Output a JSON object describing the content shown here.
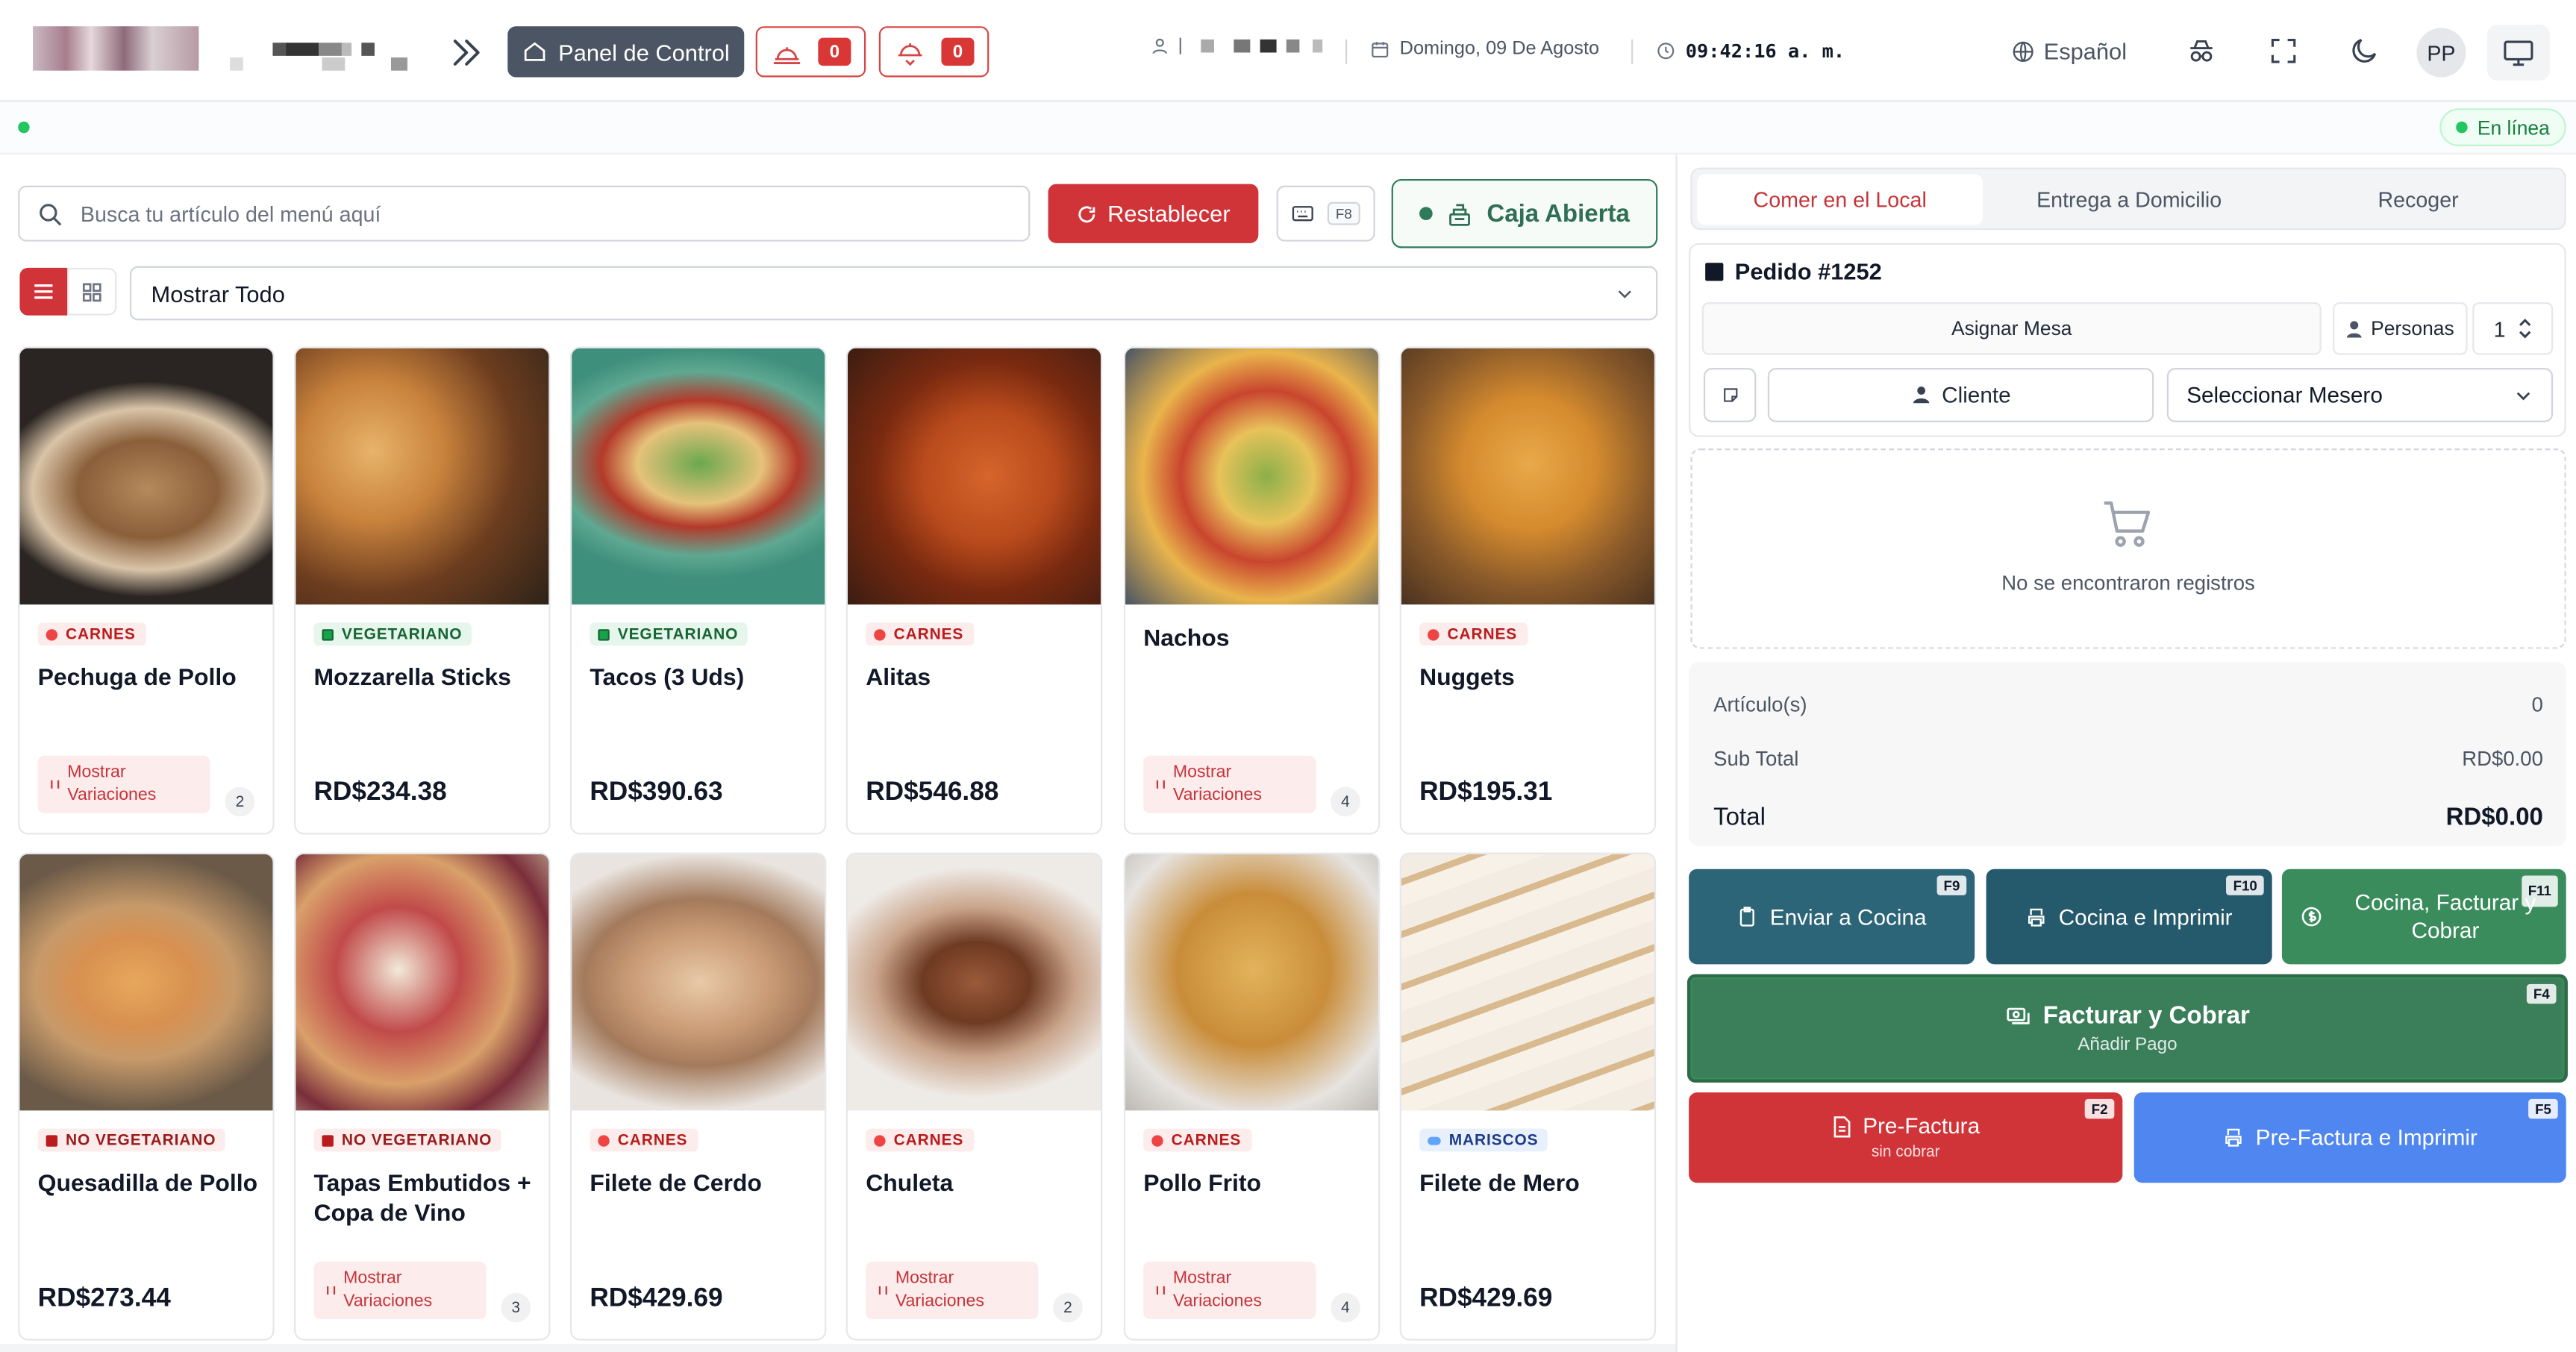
{
  "header": {
    "panel_button": "Panel de Control",
    "bell_count_1": "0",
    "bell_count_2": "0",
    "date": "Domingo, 09 De Agosto",
    "time": "09:42:16 a. m.",
    "language": "Español",
    "avatar": "PP"
  },
  "status": {
    "online": "En línea"
  },
  "toolbar": {
    "search_placeholder": "Busca tu artículo del menú aquí",
    "reset_label": "Restablecer",
    "shortcut_key": "F8",
    "cash_label": "Caja Abierta",
    "filter_value": "Mostrar Todo"
  },
  "menu_items": [
    {
      "name": "Pechuga de Pollo",
      "category": "CARNES",
      "price": "",
      "variations_label": "Mostrar Variaciones",
      "variation_count": "2"
    },
    {
      "name": "Mozzarella Sticks",
      "category": "VEGETARIANO",
      "price": "RD$234.38"
    },
    {
      "name": "Tacos (3 Uds)",
      "category": "VEGETARIANO",
      "price": "RD$390.63"
    },
    {
      "name": "Alitas",
      "category": "CARNES",
      "price": "RD$546.88"
    },
    {
      "name": "Nachos",
      "category": "",
      "price": "",
      "variations_label": "Mostrar Variaciones",
      "variation_count": "4"
    },
    {
      "name": "Nuggets",
      "category": "CARNES",
      "price": "RD$195.31"
    },
    {
      "name": "Quesadilla de Pollo",
      "category": "NO VEGETARIANO",
      "price": "RD$273.44"
    },
    {
      "name": "Tapas Embutidos + Copa de Vino",
      "category": "NO VEGETARIANO",
      "price": "",
      "variations_label": "Mostrar Variaciones",
      "variation_count": "3"
    },
    {
      "name": "Filete de Cerdo",
      "category": "CARNES",
      "price": "RD$429.69"
    },
    {
      "name": "Chuleta",
      "category": "CARNES",
      "price": "",
      "variations_label": "Mostrar Variaciones",
      "variation_count": "2"
    },
    {
      "name": "Pollo Frito",
      "category": "CARNES",
      "price": "",
      "variations_label": "Mostrar Variaciones",
      "variation_count": "4"
    },
    {
      "name": "Filete de Mero",
      "category": "MARISCOS",
      "price": "RD$429.69"
    }
  ],
  "order": {
    "tabs": [
      "Comer en el Local",
      "Entrega a Domicilio",
      "Recoger"
    ],
    "title": "Pedido #1252",
    "assign_table": "Asignar Mesa",
    "persons_label": "Personas",
    "persons_value": "1",
    "client_label": "Cliente",
    "waiter_placeholder": "Seleccionar Mesero",
    "empty_message": "No se encontraron registros",
    "items_label": "Artículo(s)",
    "items_count": "0",
    "subtotal_label": "Sub Total",
    "subtotal_value": "RD$0.00",
    "total_label": "Total",
    "total_value": "RD$0.00"
  },
  "actions": {
    "send_kitchen": "Enviar a Cocina",
    "send_kitchen_key": "F9",
    "kitchen_print": "Cocina e Imprimir",
    "kitchen_print_key": "F10",
    "kitchen_bill_charge": "Cocina, Facturar y Cobrar",
    "kitchen_bill_charge_key": "F11",
    "bill_charge": "Facturar y Cobrar",
    "bill_charge_sub": "Añadir Pago",
    "bill_charge_key": "F4",
    "pre_invoice": "Pre-Factura",
    "pre_invoice_sub": "sin cobrar",
    "pre_invoice_key": "F2",
    "pre_invoice_print": "Pre-Factura e Imprimir",
    "pre_invoice_print_key": "F5"
  },
  "colors": {
    "accent_red": "#d13438",
    "teal": "#2c6478",
    "green": "#2f7a5a",
    "blue": "#4f86f0"
  }
}
